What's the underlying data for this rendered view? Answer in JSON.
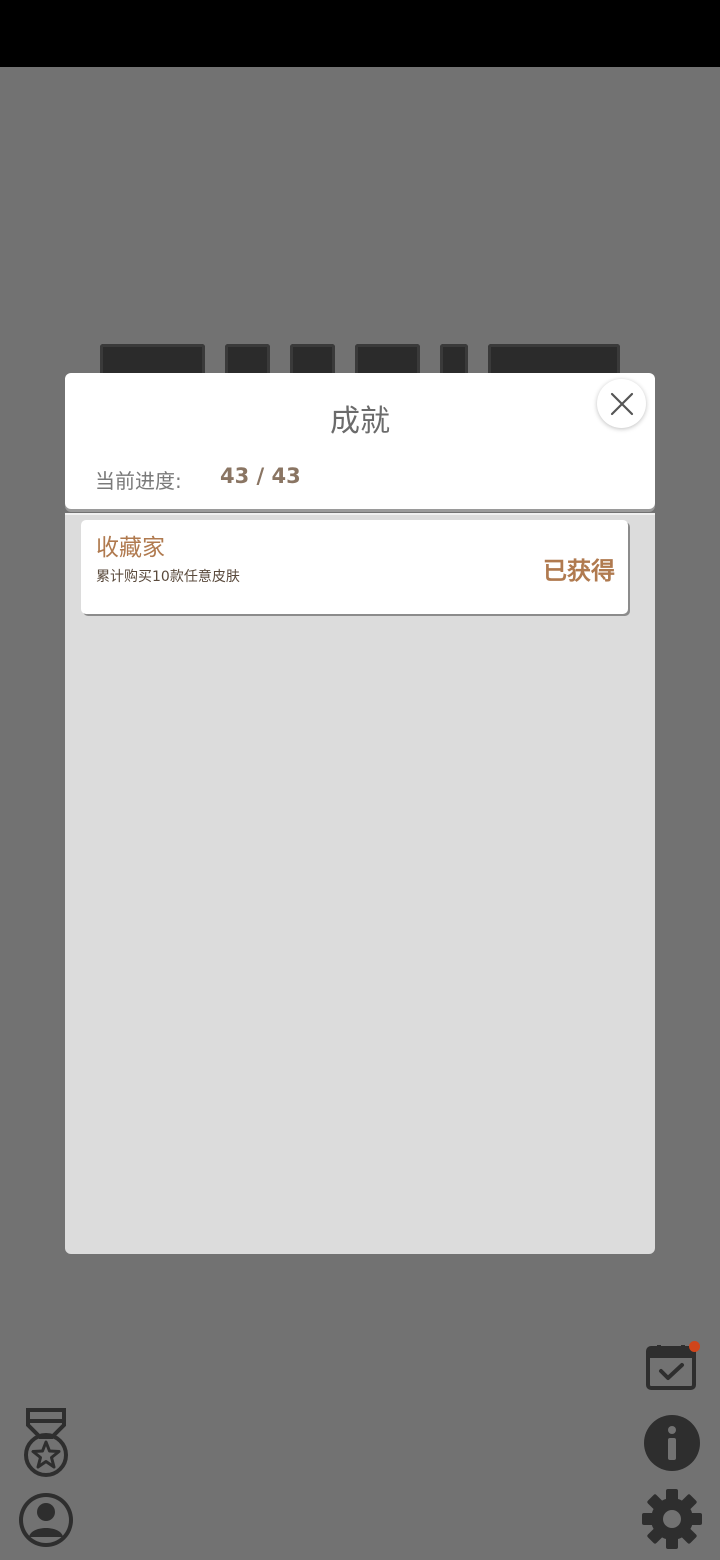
{
  "modal": {
    "title": "成就",
    "progress_label": "当前进度:",
    "progress_value": "43 / 43"
  },
  "achievements": [
    {
      "name": "收藏家",
      "description": "累计购买10款任意皮肤",
      "status": "已获得"
    }
  ],
  "icons": {
    "close": "close-icon",
    "medal": "medal-icon",
    "profile": "user-profile-icon",
    "calendar": "calendar-check-icon",
    "info": "info-icon",
    "settings": "gear-icon"
  },
  "colors": {
    "overlay": "#727272",
    "accent": "#b07a4f",
    "notification": "#d0451b"
  }
}
